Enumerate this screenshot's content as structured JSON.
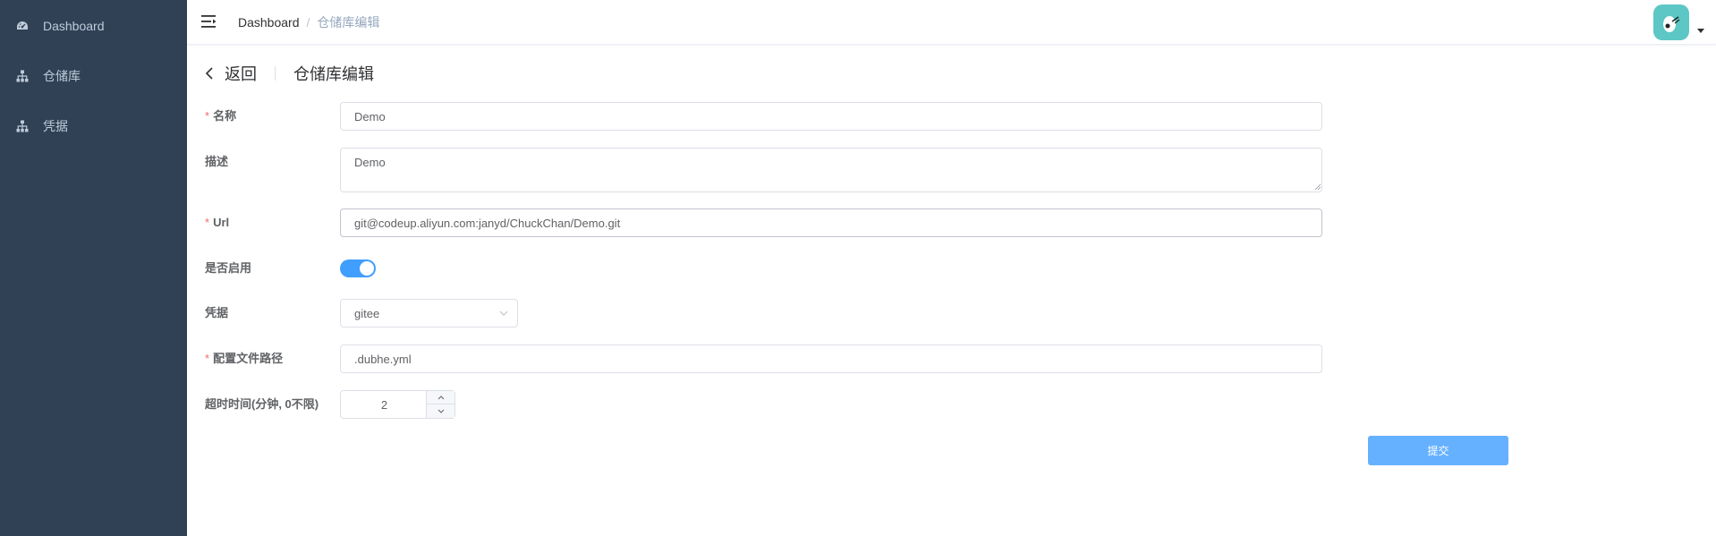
{
  "sidebar": {
    "items": [
      {
        "label": "Dashboard",
        "icon": "dashboard-icon"
      },
      {
        "label": "仓储库",
        "icon": "tree-icon"
      },
      {
        "label": "凭据",
        "icon": "tree-icon"
      }
    ]
  },
  "header": {
    "breadcrumb": {
      "home": "Dashboard",
      "separator": "/",
      "current": "仓储库编辑"
    }
  },
  "page_header": {
    "back_label": "返回",
    "title": "仓储库编辑"
  },
  "form": {
    "name": {
      "label": "名称",
      "required": "*",
      "value": "Demo"
    },
    "description": {
      "label": "描述",
      "value": "Demo"
    },
    "url": {
      "label": "Url",
      "required": "*",
      "value": "git@codeup.aliyun.com:janyd/ChuckChan/Demo.git"
    },
    "enabled": {
      "label": "是否启用",
      "value": true
    },
    "credential": {
      "label": "凭据",
      "value": "gitee"
    },
    "config_path": {
      "label": "配置文件路径",
      "required": "*",
      "value": ".dubhe.yml"
    },
    "timeout": {
      "label": "超时时间(分钟, 0不限)",
      "value": "2"
    },
    "submit_label": "提交"
  },
  "colors": {
    "sidebar_bg": "#304156",
    "accent": "#409eff",
    "submit_bg": "#66b1ff",
    "required": "#f56c6c",
    "avatar_bg": "#5cc7c4"
  }
}
